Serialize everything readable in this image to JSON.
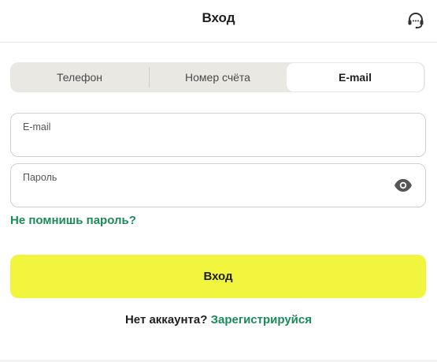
{
  "header": {
    "title": "Вход",
    "support_icon": "headset-icon"
  },
  "tabs": [
    {
      "label": "Телефон",
      "active": false
    },
    {
      "label": "Номер счёта",
      "active": false
    },
    {
      "label": "E-mail",
      "active": true
    }
  ],
  "form": {
    "email_label": "E-mail",
    "email_value": "",
    "password_label": "Пароль",
    "password_value": "",
    "eye_icon": "eye-icon",
    "forgot_label": "Не помнишь пароль?",
    "submit_label": "Вход"
  },
  "footer": {
    "no_account_text": "Нет аккаунта?",
    "register_label": "Зарегистрируйся"
  },
  "colors": {
    "accent_green": "#1c8a5a",
    "button_yellow": "#f2f53e",
    "tabs_bg": "#e9e8e3"
  }
}
